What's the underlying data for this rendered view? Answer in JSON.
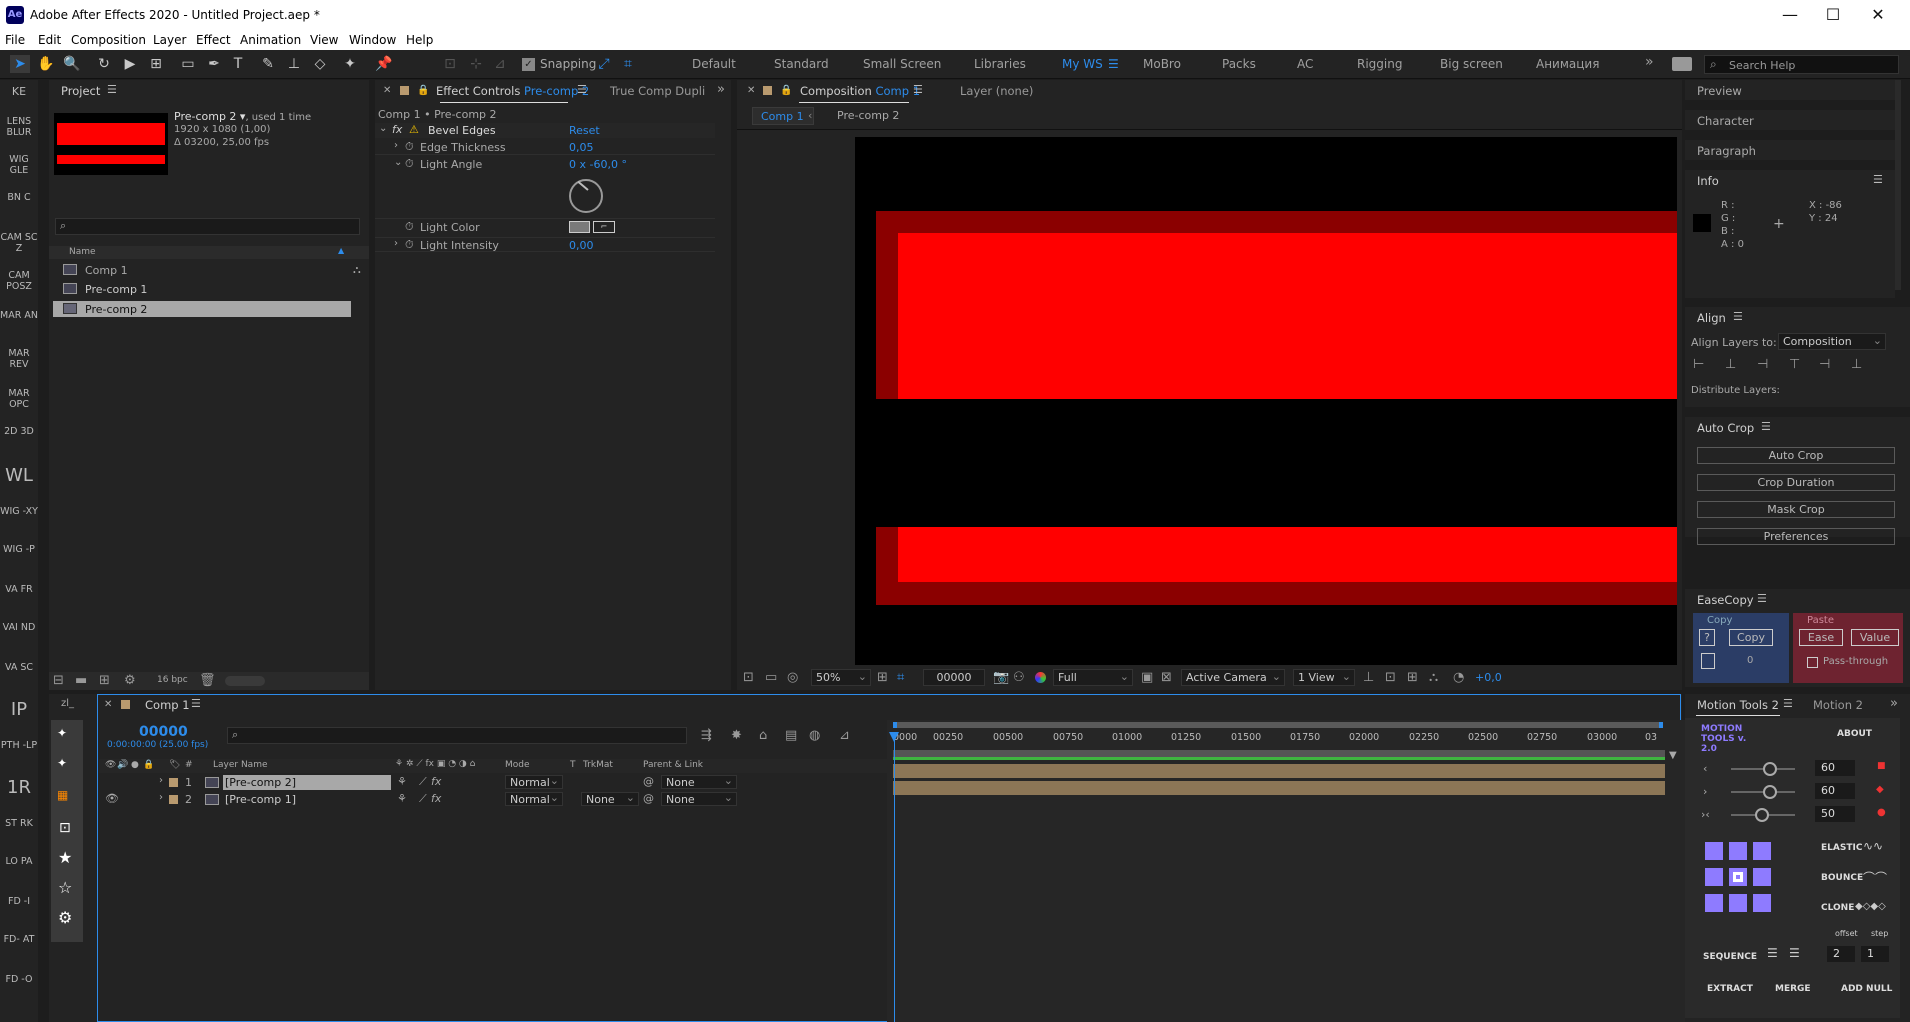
{
  "window": {
    "app_icon": "Ae",
    "title": "Adobe After Effects 2020 - Untitled Project.aep *",
    "minimize": "—",
    "maximize": "☐",
    "close": "✕"
  },
  "menu": [
    "File",
    "Edit",
    "Composition",
    "Layer",
    "Effect",
    "Animation",
    "View",
    "Window",
    "Help"
  ],
  "toolbar": {
    "snapping": "Snapping",
    "workspaces": [
      "Default",
      "Standard",
      "Small Screen",
      "Libraries",
      "My WS",
      "MoBro",
      "Packs",
      "AC",
      "Rigging",
      "Big screen",
      "Анимация"
    ],
    "active_workspace": "My WS",
    "more": "»",
    "search_help": "Search Help"
  },
  "left_scripts": [
    "KE",
    "LENS BLUR",
    "WIG GLE",
    "BN C",
    "CAM SC Z",
    "CAM POSZ",
    "MAR AN",
    "MAR REV",
    "MAR OPC",
    "2D 3D",
    "WL",
    "WIG -XY",
    "WIG -P",
    "VA FR",
    "VAI ND",
    "VA SC",
    "IP",
    "PTH -LP",
    "1R",
    "ST RK",
    "LO PA",
    "FD -I",
    "FD- AT",
    "FD -O"
  ],
  "project": {
    "tab": "Project",
    "item_name": "Pre-comp 2 ▾",
    "item_used": ", used 1 time",
    "item_dims": "1920 x 1080 (1,00)",
    "item_duration": "Δ 03200, 25,00 fps",
    "col_name": "Name",
    "items": [
      "Comp 1",
      "Pre-comp 1",
      "Pre-comp 2"
    ],
    "bpc": "16 bpc"
  },
  "effect_controls": {
    "tab": "Effect Controls",
    "tab_target": "Pre-comp 2",
    "tab2": "True Comp Dupli",
    "breadcrumb": "Comp 1 • Pre-comp 2",
    "effect": "Bevel Edges",
    "reset": "Reset",
    "props": [
      {
        "name": "Edge Thickness",
        "value": "0,05"
      },
      {
        "name": "Light Angle",
        "value": "0 x -60,0 °"
      },
      {
        "name": "Light Color",
        "value": ""
      },
      {
        "name": "Light Intensity",
        "value": "0,00"
      }
    ]
  },
  "composition": {
    "tab": "Composition",
    "tab_target": "Comp 1",
    "layer_tab": "Layer",
    "layer_value": "(none)",
    "nav": [
      "Comp 1",
      "Pre-comp 2"
    ],
    "zoom": "50%",
    "timecode": "00000",
    "resolution": "Full",
    "camera": "Active Camera",
    "views": "1 View",
    "exposure": "+0,0"
  },
  "right": {
    "preview": "Preview",
    "character": "Character",
    "paragraph": "Paragraph",
    "info": "Info",
    "info_r": "R :",
    "info_g": "G :",
    "info_b": "B :",
    "info_a": "A : 0",
    "info_x": "X : -86",
    "info_y": "Y : 24",
    "align": "Align",
    "align_to_label": "Align Layers to:",
    "align_to": "Composition",
    "distribute": "Distribute Layers:",
    "autocrop": "Auto Crop",
    "autocrop_buttons": [
      "Auto Crop",
      "Crop Duration",
      "Mask Crop",
      "Preferences"
    ],
    "easecopy": "EaseCopy",
    "copy_label": "Copy",
    "paste_label": "Paste",
    "copy_q": "?",
    "copy_btn": "Copy",
    "copy_count": "0",
    "ease_btn": "Ease",
    "value_btn": "Value",
    "passthrough": "Pass-through"
  },
  "timeline": {
    "tab": "Comp 1",
    "timecode": "00000",
    "timecode_sub": "0:00:00:00 (25.00 fps)",
    "cols": {
      "num": "#",
      "layer_name": "Layer Name",
      "mode": "Mode",
      "t": "T",
      "trkmat": "TrkMat",
      "parent": "Parent & Link"
    },
    "layers": [
      {
        "num": "1",
        "name": "[Pre-comp 2]",
        "mode": "Normal",
        "trkmat": "",
        "parent": "None"
      },
      {
        "num": "2",
        "name": "[Pre-comp 1]",
        "mode": "Normal",
        "trkmat": "None",
        "parent": "None"
      }
    ],
    "ruler": [
      "0000",
      "00250",
      "00500",
      "00750",
      "01000",
      "01250",
      "01500",
      "01750",
      "02000",
      "02250",
      "02500",
      "02750",
      "03000",
      "03"
    ]
  },
  "motion_tools": {
    "tab": "Motion Tools 2",
    "tab2": "Motion 2",
    "more": "»",
    "logo": "MOTION TOOLS v. 2.0",
    "about": "ABOUT",
    "values": [
      "60",
      "60",
      "50"
    ],
    "elastic": "ELASTIC",
    "bounce": "BOUNCE",
    "clone": "CLONE",
    "offset": "offset",
    "step": "step",
    "sequence": "SEQUENCE",
    "seq_vals": [
      "2",
      "1"
    ],
    "extract": "EXTRACT",
    "merge": "MERGE",
    "add_null": "ADD NULL"
  },
  "colors": {
    "red": "#ff0000",
    "dark_red": "#8b0000",
    "accent_blue": "#2d8ceb",
    "purple": "#8e7bff"
  }
}
